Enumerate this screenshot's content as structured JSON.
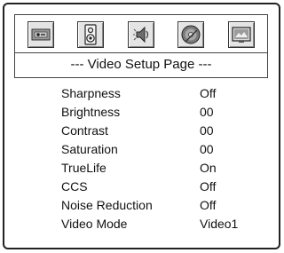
{
  "page_title": "--- Video Setup Page ---",
  "icons": [
    {
      "name": "general-setup-icon"
    },
    {
      "name": "speaker-setup-icon"
    },
    {
      "name": "audio-setup-icon"
    },
    {
      "name": "disc-setup-icon"
    },
    {
      "name": "video-setup-icon"
    }
  ],
  "settings": [
    {
      "label": "Sharpness",
      "value": "Off"
    },
    {
      "label": "Brightness",
      "value": "00"
    },
    {
      "label": "Contrast",
      "value": "00"
    },
    {
      "label": "Saturation",
      "value": "00"
    },
    {
      "label": "TrueLife",
      "value": "On"
    },
    {
      "label": "CCS",
      "value": "Off"
    },
    {
      "label": "Noise Reduction",
      "value": "Off"
    },
    {
      "label": "Video Mode",
      "value": "Video1"
    }
  ]
}
